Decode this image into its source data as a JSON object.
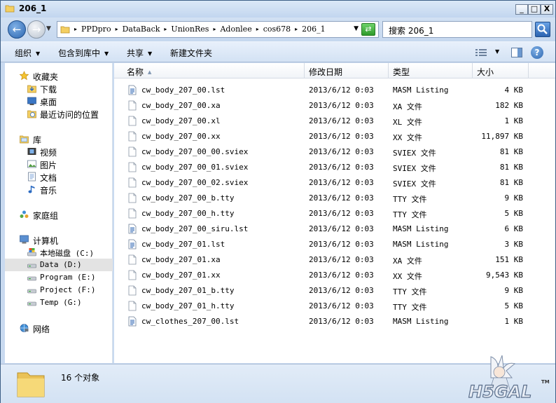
{
  "window": {
    "title": "206_1",
    "minimize_glyph": "_",
    "maximize_glyph": "□",
    "close_glyph": "X"
  },
  "address": {
    "crumbs": [
      "PPDpro",
      "DataBack",
      "UnionRes",
      "Adonlee",
      "cos678",
      "206_1"
    ],
    "search_placeholder": "搜索 206_1"
  },
  "toolbar": {
    "organize": "组织",
    "include_in_library": "包含到库中",
    "share": "共享",
    "new_folder": "新建文件夹"
  },
  "navpane": {
    "favorites": {
      "label": "收藏夹",
      "items": [
        "下载",
        "桌面",
        "最近访问的位置"
      ]
    },
    "libraries": {
      "label": "库",
      "items": [
        "视频",
        "图片",
        "文档",
        "音乐"
      ]
    },
    "homegroup": "家庭组",
    "computer": {
      "label": "计算机",
      "drives": [
        "本地磁盘 (C:)",
        "Data (D:)",
        "Program (E:)",
        "Project (F:)",
        "Temp (G:)"
      ]
    },
    "network": "网络"
  },
  "columns": {
    "name": "名称",
    "modified": "修改日期",
    "type": "类型",
    "size": "大小"
  },
  "files": [
    {
      "name": "cw_body_207_00.lst",
      "modified": "2013/6/12 0:03",
      "type": "MASM Listing",
      "size": "4 KB",
      "icon": "lst-file-icon"
    },
    {
      "name": "cw_body_207_00.xa",
      "modified": "2013/6/12 0:03",
      "type": "XA 文件",
      "size": "182 KB",
      "icon": "blank-file-icon"
    },
    {
      "name": "cw_body_207_00.xl",
      "modified": "2013/6/12 0:03",
      "type": "XL 文件",
      "size": "1 KB",
      "icon": "blank-file-icon"
    },
    {
      "name": "cw_body_207_00.xx",
      "modified": "2013/6/12 0:03",
      "type": "XX 文件",
      "size": "11,897 KB",
      "icon": "blank-file-icon"
    },
    {
      "name": "cw_body_207_00_00.sviex",
      "modified": "2013/6/12 0:03",
      "type": "SVIEX 文件",
      "size": "81 KB",
      "icon": "blank-file-icon"
    },
    {
      "name": "cw_body_207_00_01.sviex",
      "modified": "2013/6/12 0:03",
      "type": "SVIEX 文件",
      "size": "81 KB",
      "icon": "blank-file-icon"
    },
    {
      "name": "cw_body_207_00_02.sviex",
      "modified": "2013/6/12 0:03",
      "type": "SVIEX 文件",
      "size": "81 KB",
      "icon": "blank-file-icon"
    },
    {
      "name": "cw_body_207_00_b.tty",
      "modified": "2013/6/12 0:03",
      "type": "TTY 文件",
      "size": "9 KB",
      "icon": "blank-file-icon"
    },
    {
      "name": "cw_body_207_00_h.tty",
      "modified": "2013/6/12 0:03",
      "type": "TTY 文件",
      "size": "5 KB",
      "icon": "blank-file-icon"
    },
    {
      "name": "cw_body_207_00_siru.lst",
      "modified": "2013/6/12 0:03",
      "type": "MASM Listing",
      "size": "6 KB",
      "icon": "lst-file-icon"
    },
    {
      "name": "cw_body_207_01.lst",
      "modified": "2013/6/12 0:03",
      "type": "MASM Listing",
      "size": "3 KB",
      "icon": "lst-file-icon"
    },
    {
      "name": "cw_body_207_01.xa",
      "modified": "2013/6/12 0:03",
      "type": "XA 文件",
      "size": "151 KB",
      "icon": "blank-file-icon"
    },
    {
      "name": "cw_body_207_01.xx",
      "modified": "2013/6/12 0:03",
      "type": "XX 文件",
      "size": "9,543 KB",
      "icon": "blank-file-icon"
    },
    {
      "name": "cw_body_207_01_b.tty",
      "modified": "2013/6/12 0:03",
      "type": "TTY 文件",
      "size": "9 KB",
      "icon": "blank-file-icon"
    },
    {
      "name": "cw_body_207_01_h.tty",
      "modified": "2013/6/12 0:03",
      "type": "TTY 文件",
      "size": "5 KB",
      "icon": "blank-file-icon"
    },
    {
      "name": "cw_clothes_207_00.lst",
      "modified": "2013/6/12 0:03",
      "type": "MASM Listing",
      "size": "1 KB",
      "icon": "lst-file-icon"
    }
  ],
  "status": {
    "count": "16 个对象"
  },
  "watermark": {
    "text": "H5GAL",
    "tm": "TM"
  },
  "colors": {
    "chrome": "#c9daf0",
    "selected_nav": "#e3e3e3",
    "accent_blue": "#2c66b0"
  }
}
